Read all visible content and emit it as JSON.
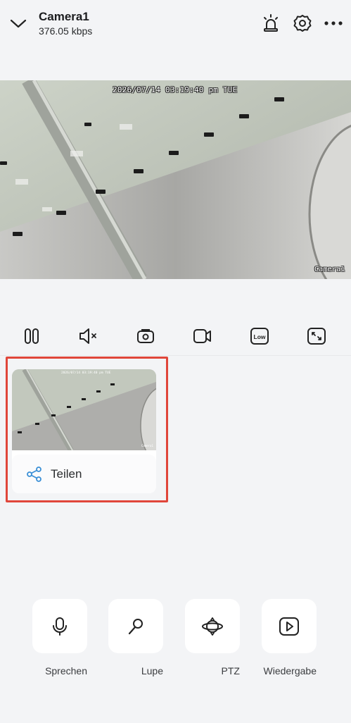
{
  "header": {
    "title": "Camera1",
    "bitrate": "376.05 kbps",
    "icons": [
      "chevron-down-icon",
      "alarm-light-icon",
      "gear-icon",
      "more-dots-icon"
    ]
  },
  "video": {
    "timestamp": "2026/07/14 03:19:40 pm TUE",
    "camera_label": "Camera1"
  },
  "controls": {
    "icons": [
      "pause-icon",
      "mute-icon",
      "snapshot-icon",
      "record-icon",
      "quality-icon",
      "fullscreen-icon"
    ],
    "quality_label": "Low"
  },
  "snapshot": {
    "share_label": "Teilen"
  },
  "actions": [
    {
      "label": "Sprechen",
      "icon": "microphone-icon"
    },
    {
      "label": "Lupe",
      "icon": "magnifier-icon"
    },
    {
      "label": "PTZ",
      "icon": "ptz-icon"
    },
    {
      "label": "Wiedergabe",
      "icon": "playback-icon"
    }
  ],
  "colors": {
    "background": "#f3f4f6",
    "highlight_border": "#e0463a",
    "share_accent": "#3a8fd6"
  }
}
